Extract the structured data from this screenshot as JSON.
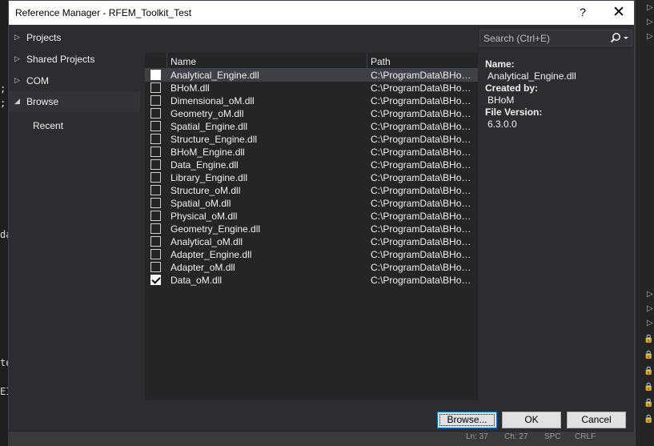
{
  "window": {
    "title": "Reference Manager - RFEM_Toolkit_Test",
    "help_label": "?",
    "close_label": "✕"
  },
  "nav": {
    "items": [
      {
        "label": "Projects",
        "arrow": "▷"
      },
      {
        "label": "Shared Projects",
        "arrow": "▷"
      },
      {
        "label": "COM",
        "arrow": "▷"
      },
      {
        "label": "Browse",
        "arrow": "◢"
      }
    ],
    "sub_item": "Recent"
  },
  "list": {
    "columns": {
      "name": "Name",
      "path": "Path"
    },
    "rows": [
      {
        "name": "Analytical_Engine.dll",
        "path": "C:\\ProgramData\\BHoM\\Assemblies\\Analytical_Engine.dll",
        "checked": false,
        "selected": true
      },
      {
        "name": "BHoM.dll",
        "path": "C:\\ProgramData\\BHoM\\Assemblies\\BHoM.dll",
        "checked": false
      },
      {
        "name": "Dimensional_oM.dll",
        "path": "C:\\ProgramData\\BHoM\\Assemblies\\Dimensional_oM.dll",
        "checked": false
      },
      {
        "name": "Geometry_oM.dll",
        "path": "C:\\ProgramData\\BHoM\\Assemblies\\Geometry_oM.dll",
        "checked": false
      },
      {
        "name": "Spatial_Engine.dll",
        "path": "C:\\ProgramData\\BHoM\\Assemblies\\Spatial_Engine.dll",
        "checked": false
      },
      {
        "name": "Structure_Engine.dll",
        "path": "C:\\ProgramData\\BHoM\\Assemblies\\Structure_Engine.dll",
        "checked": false
      },
      {
        "name": "BHoM_Engine.dll",
        "path": "C:\\ProgramData\\BHoM\\Assemblies\\BHoM_Engine.dll",
        "checked": false
      },
      {
        "name": "Data_Engine.dll",
        "path": "C:\\ProgramData\\BHoM\\Assemblies\\Data_Engine.dll",
        "checked": false
      },
      {
        "name": "Library_Engine.dll",
        "path": "C:\\ProgramData\\BHoM\\Assemblies\\Library_Engine.dll",
        "checked": false
      },
      {
        "name": "Structure_oM.dll",
        "path": "C:\\ProgramData\\BHoM\\Assemblies\\Structure_oM.dll",
        "checked": false
      },
      {
        "name": "Spatial_oM.dll",
        "path": "C:\\ProgramData\\BHoM\\Assemblies\\Spatial_oM.dll",
        "checked": false
      },
      {
        "name": "Physical_oM.dll",
        "path": "C:\\ProgramData\\BHoM\\Assemblies\\Physical_oM.dll",
        "checked": false
      },
      {
        "name": "Geometry_Engine.dll",
        "path": "C:\\ProgramData\\BHoM\\Assemblies\\Geometry_Engine.dll",
        "checked": false
      },
      {
        "name": "Analytical_oM.dll",
        "path": "C:\\ProgramData\\BHoM\\Assemblies\\Analytical_oM.dll",
        "checked": false
      },
      {
        "name": "Adapter_Engine.dll",
        "path": "C:\\ProgramData\\BHoM\\Assemblies\\Adapter_Engine.dll",
        "checked": false
      },
      {
        "name": "Adapter_oM.dll",
        "path": "C:\\ProgramData\\BHoM\\Assemblies\\Adapter_oM.dll",
        "checked": false
      },
      {
        "name": "Data_oM.dll",
        "path": "C:\\ProgramData\\BHoM\\Assemblies\\Data_oM.dll",
        "checked": true
      }
    ]
  },
  "search": {
    "placeholder": "Search (Ctrl+E)",
    "value": ""
  },
  "details": {
    "name_label": "Name:",
    "name_value": "Analytical_Engine.dll",
    "created_label": "Created by:",
    "created_value": "BHoM",
    "version_label": "File Version:",
    "version_value": "6.3.0.0"
  },
  "buttons": {
    "browse": "Browse...",
    "ok": "OK",
    "cancel": "Cancel"
  },
  "background": {
    "left_fragments": [
      ";",
      ";",
      "da",
      "te",
      "EI"
    ],
    "status": [
      "Ln: 37",
      "Ch: 27",
      "SPC",
      "CRLF"
    ]
  },
  "colors": {
    "dialog_bg": "#2d2d30",
    "list_bg": "#252526",
    "selected_row": "#3f3f46",
    "accent": "#0078d7"
  }
}
